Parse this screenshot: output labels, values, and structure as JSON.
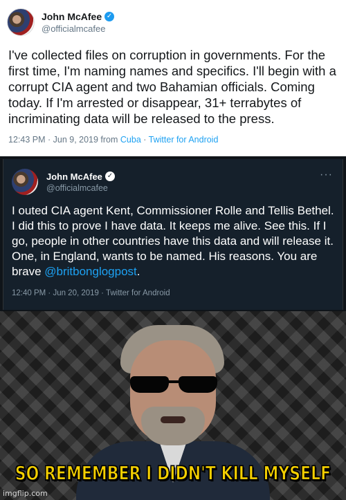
{
  "tweet1": {
    "name": "John McAfee",
    "handle": "@officialmcafee",
    "text": "I've collected files on corruption in governments. For the first time, I'm naming names and specifics. I'll begin with a corrupt CIA agent and two Bahamian officials. Coming today. If I'm arrested or disappear, 31+ terrabytes of incriminating data will be released to the press.",
    "time": "12:43 PM · Jun 9, 2019 from ",
    "location": "Cuba",
    "separator": " · ",
    "source": "Twitter for Android"
  },
  "tweet2": {
    "name": "John McAfee",
    "handle": "@officialmcafee",
    "text_before_mention": "I outed CIA agent Kent, Commissioner Rolle and Tellis Bethel. I did this to prove I have data. It keeps me alive. See this. If I go, people in other countries have this data and will release it. One, in England, wants to be named. His reasons. You are brave ",
    "mention": "@britbonglogpost",
    "text_after_mention": ".",
    "meta": "12:40 PM · Jun 20, 2019 · Twitter for Android"
  },
  "photo": {
    "caption": "SO REMEMBER I DIDN'T KILL MYSELF",
    "watermark": "imgflip.com"
  },
  "colors": {
    "link": "#1da1f2",
    "verified_light": "#1d9bf0",
    "caption": "#f5d000"
  }
}
